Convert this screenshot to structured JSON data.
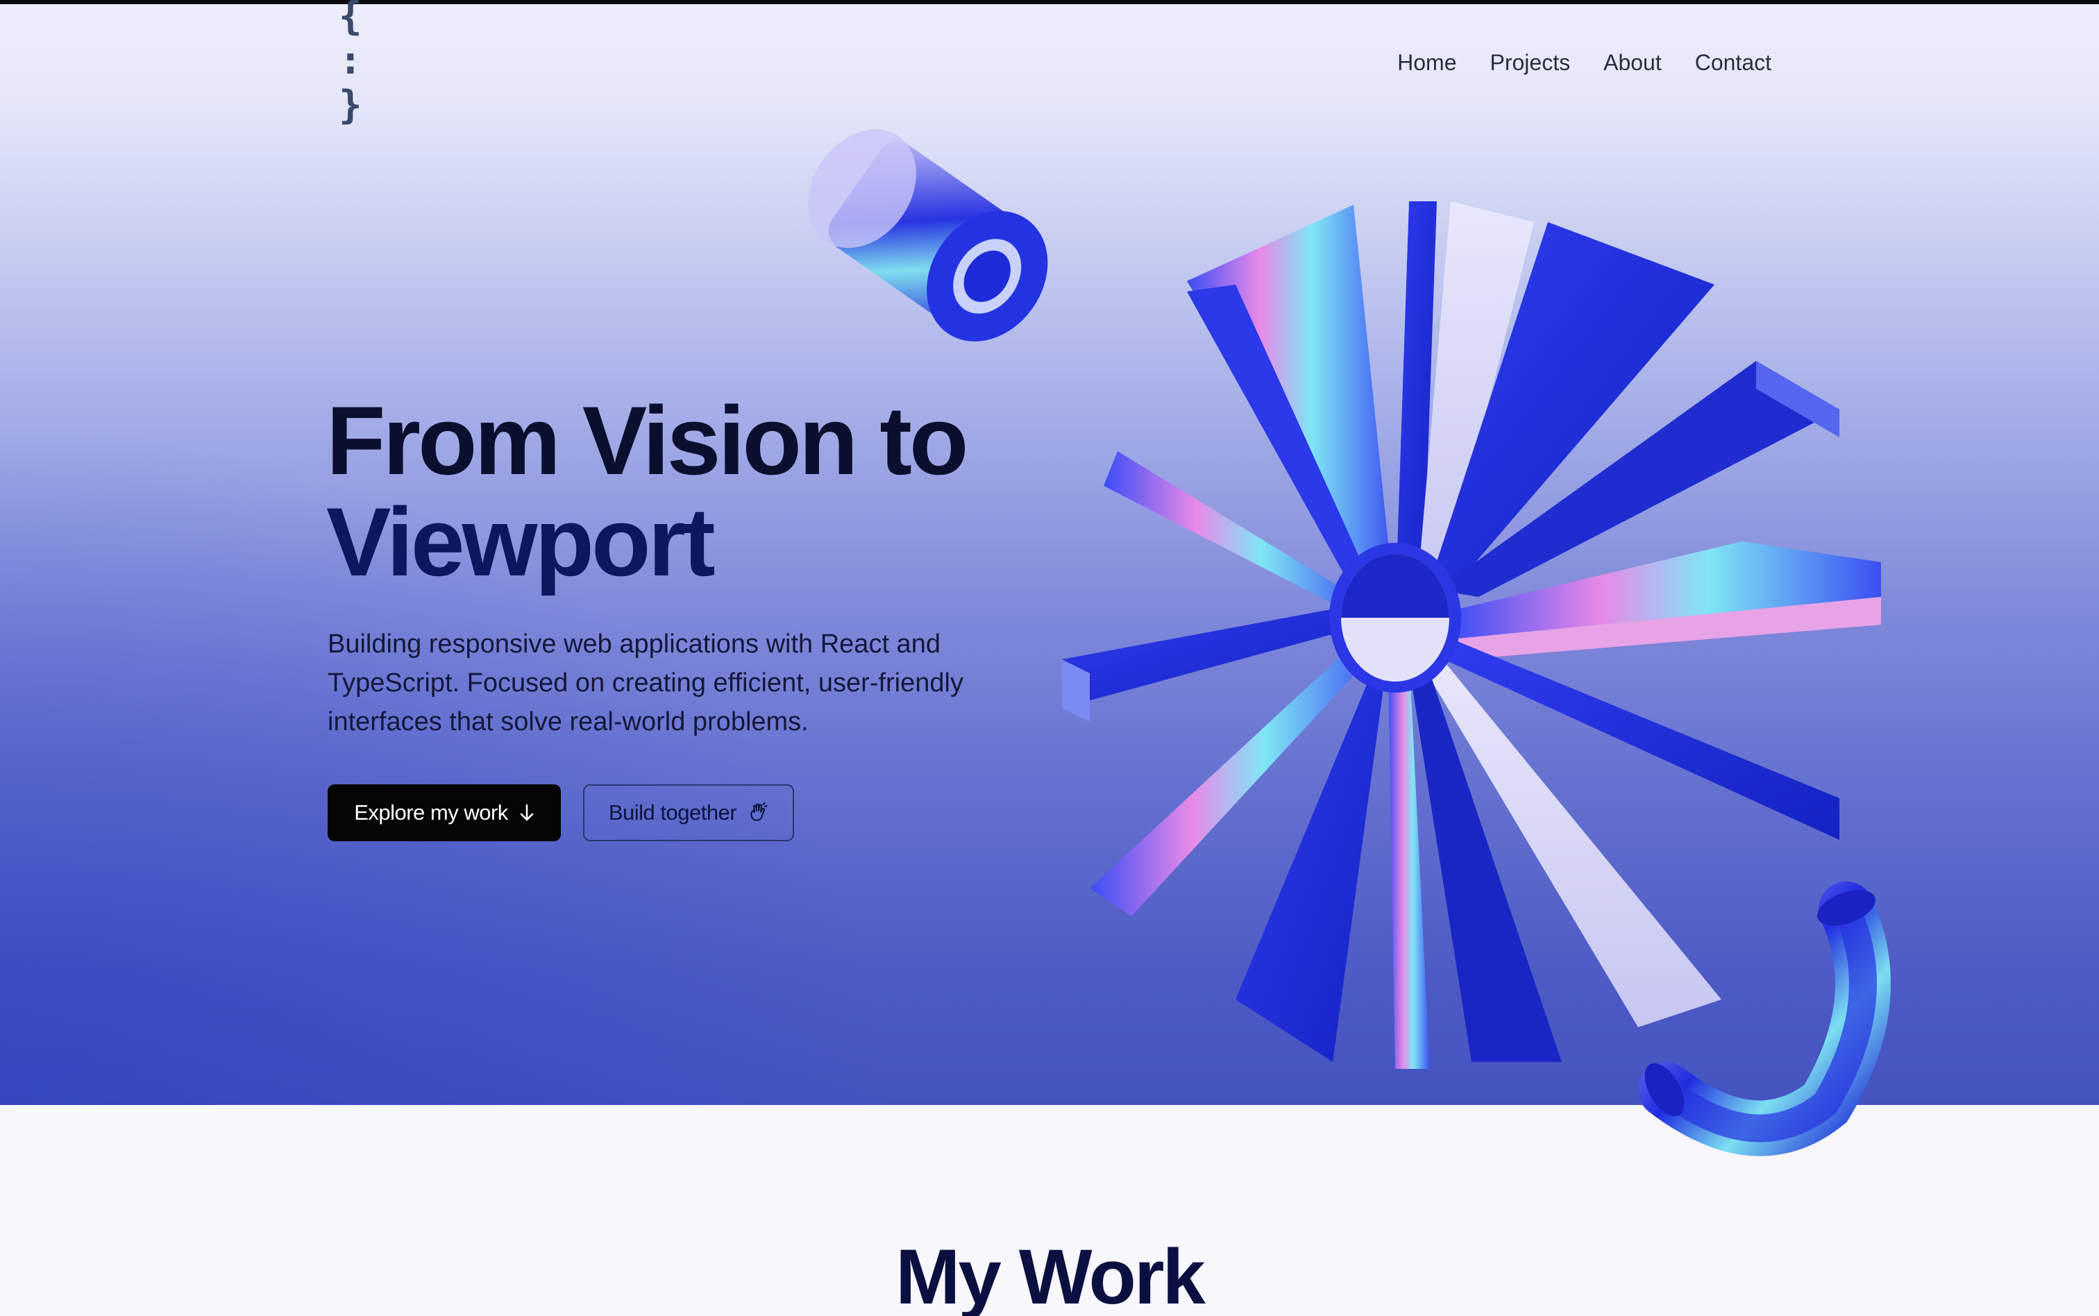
{
  "header": {
    "logo_text": "{ : }",
    "nav": [
      {
        "label": "Home"
      },
      {
        "label": "Projects"
      },
      {
        "label": "About"
      },
      {
        "label": "Contact"
      }
    ]
  },
  "hero": {
    "headline_line1": "From Vision to",
    "headline_line2": "Viewport",
    "subtext": "Building responsive web applications with React and TypeScript. Focused on creating efficient, user-friendly interfaces that solve real-world problems.",
    "primary_button": {
      "label": "Explore my work",
      "icon": "arrow-down-icon"
    },
    "secondary_button": {
      "label": "Build together",
      "icon": "hand-wave-icon"
    }
  },
  "work_section": {
    "title": "My Work"
  },
  "colors": {
    "text_dark": "#0b0f2e",
    "accent_navy": "#0c1760",
    "shape_blue": "#1d2ee0",
    "button_black": "#050505"
  }
}
